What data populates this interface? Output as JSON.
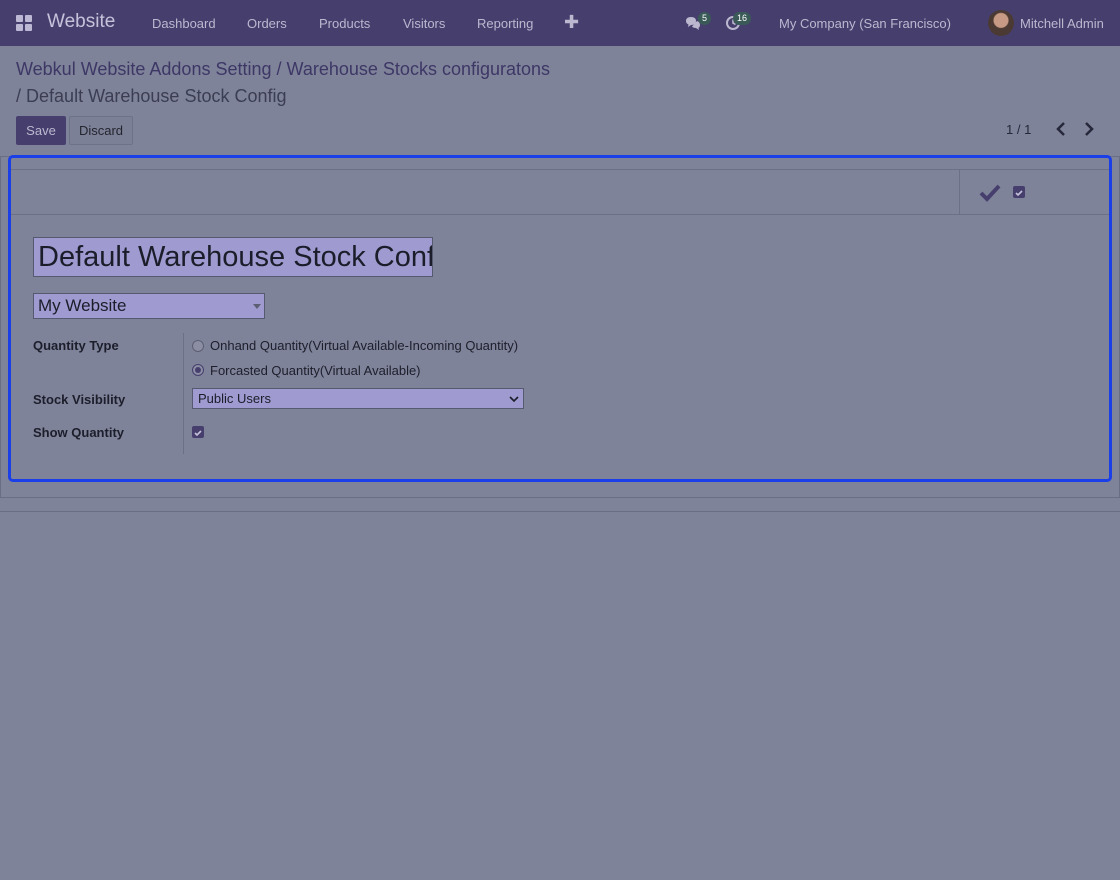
{
  "navbar": {
    "brand": "Website",
    "menu": [
      "Dashboard",
      "Orders",
      "Products",
      "Visitors",
      "Reporting"
    ],
    "messages_count": "5",
    "activities_count": "16",
    "company": "My Company (San Francisco)",
    "user": "Mitchell Admin"
  },
  "breadcrumb": {
    "item1": "Webkul Website Addons Setting",
    "item2": "Warehouse Stocks configuratons",
    "current": "Default Warehouse Stock Config",
    "separator": "/"
  },
  "buttons": {
    "save": "Save",
    "discard": "Discard"
  },
  "pager": {
    "value": "1 / 1"
  },
  "form": {
    "name": "Default Warehouse Stock Config",
    "website": "My Website",
    "quantity_type_label": "Quantity Type",
    "quantity_type_options": [
      "Onhand Quantity(Virtual Available-Incoming Quantity)",
      "Forcasted Quantity(Virtual Available)"
    ],
    "quantity_type_selected": 1,
    "stock_visibility_label": "Stock Visibility",
    "stock_visibility_value": "Public Users",
    "show_quantity_label": "Show Quantity",
    "show_quantity": true,
    "active": true
  },
  "colors": {
    "navbar": "#463f6e",
    "primary": "#463f6e",
    "focus_border": "#1a3ee8",
    "overlay": "#7f8399"
  }
}
